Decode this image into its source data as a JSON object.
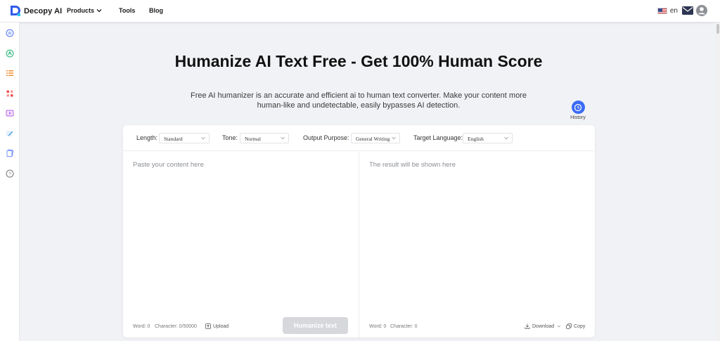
{
  "header": {
    "brand": "Decopy AI",
    "nav": {
      "products": "Products",
      "tools": "Tools",
      "blog": "Blog"
    },
    "language": "en"
  },
  "sidebar": {
    "items": [
      {
        "icon": "ai-detector-icon",
        "color": "#5b7cf7"
      },
      {
        "icon": "humanizer-icon",
        "color": "#2fb67c"
      },
      {
        "icon": "list-icon",
        "color": "#f08a24"
      },
      {
        "icon": "apps-icon",
        "color": "#ef4d4d"
      },
      {
        "icon": "video-icon",
        "color": "#b45be8"
      },
      {
        "icon": "edit-icon",
        "color": "#4aa3e8"
      },
      {
        "icon": "cards-icon",
        "color": "#5b7cf7"
      },
      {
        "icon": "help-icon",
        "color": "#777777"
      }
    ]
  },
  "main": {
    "title": "Humanize AI Text Free - Get 100% Human Score",
    "description": "Free AI humanizer is an accurate and efficient ai to human text converter. Make your content more human-like and undetectable, easily bypasses AI detection.",
    "history_label": "History"
  },
  "options": {
    "length": {
      "label": "Length:",
      "value": "Standard"
    },
    "tone": {
      "label": "Tone:",
      "value": "Normal"
    },
    "purpose": {
      "label": "Output Purpose:",
      "value": "General Writing"
    },
    "language": {
      "label": "Target Language:",
      "value": "English"
    }
  },
  "input_pane": {
    "placeholder": "Paste your content here",
    "word_count": "Word: 0",
    "char_count": "Character: 0/50000",
    "upload_label": "Upload",
    "humanize_label": "Humanize text"
  },
  "output_pane": {
    "placeholder": "The result will be shown here",
    "word_count": "Word: 0",
    "char_count": "Character: 0",
    "download_label": "Download",
    "copy_label": "Copy"
  },
  "colors": {
    "accent": "#3b6cf6",
    "background": "#f1f2f5",
    "disabled_button": "#d6d8dc"
  }
}
